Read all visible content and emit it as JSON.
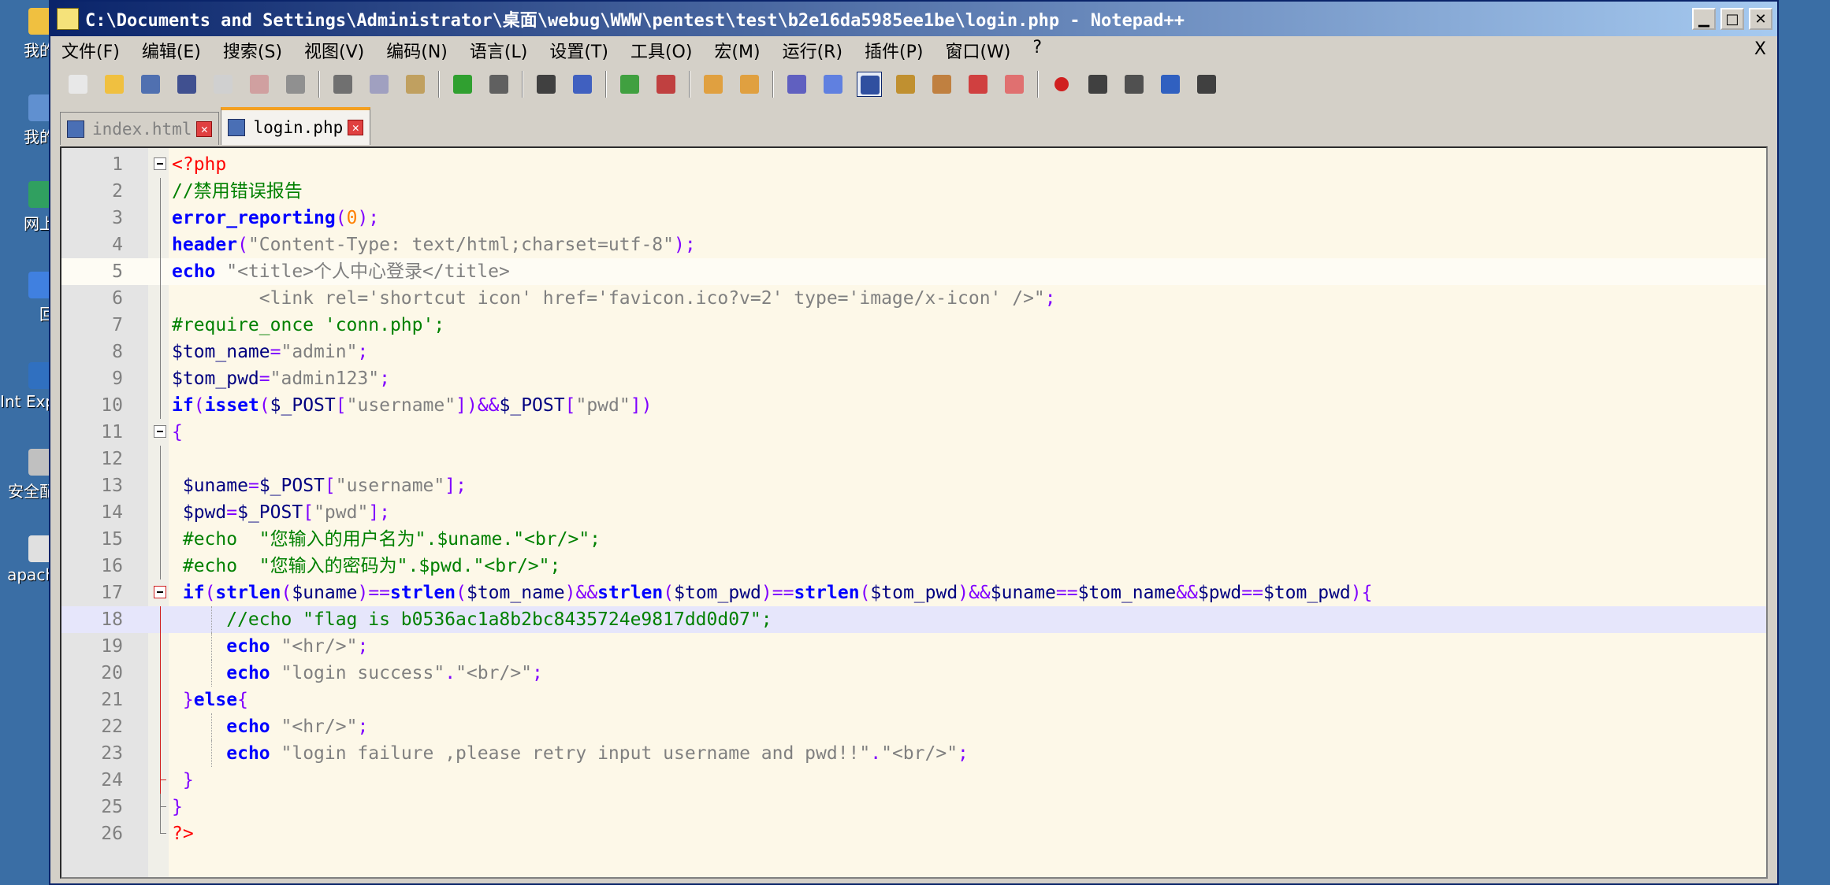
{
  "window": {
    "title": "C:\\Documents and Settings\\Administrator\\桌面\\webug\\WWW\\pentest\\test\\b2e16da5985ee1be\\login.php - Notepad++",
    "minimize": "▁",
    "maximize": "□",
    "close": "✕"
  },
  "desktop": {
    "icons": [
      {
        "label": "我的"
      },
      {
        "label": "我的"
      },
      {
        "label": "网上"
      },
      {
        "label": "回"
      },
      {
        "label": "Int Exp"
      },
      {
        "label": "安全配"
      },
      {
        "label": "apach"
      }
    ]
  },
  "menu": {
    "items": [
      "文件(F)",
      "编辑(E)",
      "搜索(S)",
      "视图(V)",
      "编码(N)",
      "语言(L)",
      "设置(T)",
      "工具(O)",
      "宏(M)",
      "运行(R)",
      "插件(P)",
      "窗口(W)",
      "?"
    ],
    "close": "X"
  },
  "toolbar": {
    "buttons": [
      "new-file",
      "open-file",
      "save",
      "save-all",
      "close",
      "close-all",
      "print",
      "cut",
      "copy",
      "paste",
      "undo",
      "redo",
      "find",
      "replace",
      "zoom-in",
      "zoom-out",
      "sync-vertical",
      "sync-horizontal",
      "word-wrap",
      "show-all-chars",
      "indent-guide",
      "doc-map",
      "function-list",
      "folder-workspace",
      "monitor",
      "record-macro",
      "stop-macro",
      "play-macro",
      "run-macro-multiple",
      "save-macro"
    ]
  },
  "tabs": [
    {
      "label": "index.html",
      "active": false
    },
    {
      "label": "login.php",
      "active": true
    }
  ],
  "editor": {
    "lines": [
      {
        "n": "1",
        "tokens": [
          [
            "php",
            "<?php"
          ]
        ]
      },
      {
        "n": "2",
        "tokens": [
          [
            "cmt",
            "//禁用错误报告"
          ]
        ]
      },
      {
        "n": "3",
        "tokens": [
          [
            "kw",
            "error_reporting"
          ],
          [
            "op",
            "("
          ],
          [
            "num",
            "0"
          ],
          [
            "op",
            ");"
          ]
        ]
      },
      {
        "n": "4",
        "tokens": [
          [
            "kw",
            "header"
          ],
          [
            "op",
            "("
          ],
          [
            "str",
            "\"Content-Type: text/html;charset=utf-8\""
          ],
          [
            "op",
            ");"
          ]
        ]
      },
      {
        "n": "5",
        "tokens": [
          [
            "kw",
            "echo"
          ],
          [
            "plain",
            " "
          ],
          [
            "str",
            "\"<title>个人中心登录</title>"
          ]
        ]
      },
      {
        "n": "6",
        "tokens": [
          [
            "str",
            "        <link rel='shortcut icon' href='favicon.ico?v=2' type='image/x-icon' />\""
          ],
          [
            "op",
            ";"
          ]
        ]
      },
      {
        "n": "7",
        "tokens": [
          [
            "cmt",
            "#require_once 'conn.php';"
          ]
        ]
      },
      {
        "n": "8",
        "tokens": [
          [
            "var",
            "$tom_name"
          ],
          [
            "op",
            "="
          ],
          [
            "str",
            "\"admin\""
          ],
          [
            "op",
            ";"
          ]
        ]
      },
      {
        "n": "9",
        "tokens": [
          [
            "var",
            "$tom_pwd"
          ],
          [
            "op",
            "="
          ],
          [
            "str",
            "\"admin123\""
          ],
          [
            "op",
            ";"
          ]
        ]
      },
      {
        "n": "10",
        "tokens": [
          [
            "kw",
            "if"
          ],
          [
            "op",
            "("
          ],
          [
            "kw",
            "isset"
          ],
          [
            "op",
            "("
          ],
          [
            "var",
            "$_POST"
          ],
          [
            "op",
            "["
          ],
          [
            "str",
            "\"username\""
          ],
          [
            "op",
            "])"
          ],
          [
            "op",
            "&&"
          ],
          [
            "var",
            "$_POST"
          ],
          [
            "op",
            "["
          ],
          [
            "str",
            "\"pwd\""
          ],
          [
            "op",
            "])"
          ]
        ]
      },
      {
        "n": "11",
        "tokens": [
          [
            "op",
            "{"
          ]
        ]
      },
      {
        "n": "12",
        "tokens": []
      },
      {
        "n": "13",
        "tokens": [
          [
            "plain",
            " "
          ],
          [
            "var",
            "$uname"
          ],
          [
            "op",
            "="
          ],
          [
            "var",
            "$_POST"
          ],
          [
            "op",
            "["
          ],
          [
            "str",
            "\"username\""
          ],
          [
            "op",
            "];"
          ]
        ]
      },
      {
        "n": "14",
        "tokens": [
          [
            "plain",
            " "
          ],
          [
            "var",
            "$pwd"
          ],
          [
            "op",
            "="
          ],
          [
            "var",
            "$_POST"
          ],
          [
            "op",
            "["
          ],
          [
            "str",
            "\"pwd\""
          ],
          [
            "op",
            "];"
          ]
        ]
      },
      {
        "n": "15",
        "tokens": [
          [
            "cmt",
            " #echo  \"您输入的用户名为\".$uname.\"<br/>\";"
          ]
        ]
      },
      {
        "n": "16",
        "tokens": [
          [
            "cmt",
            " #echo  \"您输入的密码为\".$pwd.\"<br/>\";"
          ]
        ]
      },
      {
        "n": "17",
        "tokens": [
          [
            "plain",
            " "
          ],
          [
            "kw",
            "if"
          ],
          [
            "op",
            "("
          ],
          [
            "kw",
            "strlen"
          ],
          [
            "op",
            "("
          ],
          [
            "var",
            "$uname"
          ],
          [
            "op",
            ")"
          ],
          [
            "op",
            "=="
          ],
          [
            "kw",
            "strlen"
          ],
          [
            "op",
            "("
          ],
          [
            "var",
            "$tom_name"
          ],
          [
            "op",
            ")"
          ],
          [
            "op",
            "&&"
          ],
          [
            "kw",
            "strlen"
          ],
          [
            "op",
            "("
          ],
          [
            "var",
            "$tom_pwd"
          ],
          [
            "op",
            ")"
          ],
          [
            "op",
            "=="
          ],
          [
            "kw",
            "strlen"
          ],
          [
            "op",
            "("
          ],
          [
            "var",
            "$tom_pwd"
          ],
          [
            "op",
            ")"
          ],
          [
            "op",
            "&&"
          ],
          [
            "var",
            "$uname"
          ],
          [
            "op",
            "=="
          ],
          [
            "var",
            "$tom_name"
          ],
          [
            "op",
            "&&"
          ],
          [
            "var",
            "$pwd"
          ],
          [
            "op",
            "=="
          ],
          [
            "var",
            "$tom_pwd"
          ],
          [
            "op",
            "){"
          ]
        ]
      },
      {
        "n": "18",
        "tokens": [
          [
            "cmt",
            "     //echo \"flag is b0536ac1a8b2bc8435724e9817dd0d07\";"
          ]
        ]
      },
      {
        "n": "19",
        "tokens": [
          [
            "plain",
            "     "
          ],
          [
            "kw",
            "echo"
          ],
          [
            "plain",
            " "
          ],
          [
            "str",
            "\"<hr/>\""
          ],
          [
            "op",
            ";"
          ]
        ]
      },
      {
        "n": "20",
        "tokens": [
          [
            "plain",
            "     "
          ],
          [
            "kw",
            "echo"
          ],
          [
            "plain",
            " "
          ],
          [
            "str",
            "\"login success\""
          ],
          [
            "op",
            "."
          ],
          [
            "str",
            "\"<br/>\""
          ],
          [
            "op",
            ";"
          ]
        ]
      },
      {
        "n": "21",
        "tokens": [
          [
            "plain",
            " "
          ],
          [
            "op",
            "}"
          ],
          [
            "kw",
            "else"
          ],
          [
            "op",
            "{"
          ]
        ]
      },
      {
        "n": "22",
        "tokens": [
          [
            "plain",
            "     "
          ],
          [
            "kw",
            "echo"
          ],
          [
            "plain",
            " "
          ],
          [
            "str",
            "\"<hr/>\""
          ],
          [
            "op",
            ";"
          ]
        ]
      },
      {
        "n": "23",
        "tokens": [
          [
            "plain",
            "     "
          ],
          [
            "kw",
            "echo"
          ],
          [
            "plain",
            " "
          ],
          [
            "str",
            "\"login failure ,please retry input username and pwd!!\""
          ],
          [
            "op",
            "."
          ],
          [
            "str",
            "\"<br/>\""
          ],
          [
            "op",
            ";"
          ]
        ]
      },
      {
        "n": "24",
        "tokens": [
          [
            "plain",
            " "
          ],
          [
            "op",
            "}"
          ]
        ]
      },
      {
        "n": "25",
        "tokens": [
          [
            "op",
            "}"
          ]
        ]
      },
      {
        "n": "26",
        "tokens": [
          [
            "php",
            "?>"
          ]
        ]
      }
    ]
  }
}
